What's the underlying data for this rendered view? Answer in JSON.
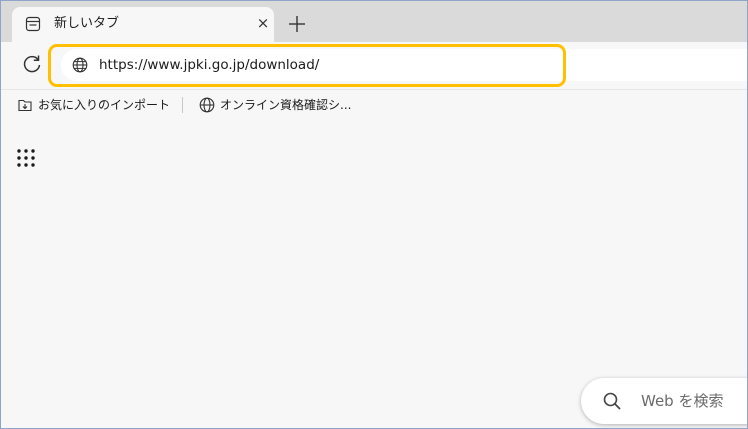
{
  "tab": {
    "title": "新しいタブ",
    "close_glyph": "×",
    "icon": "new-tab-page-icon"
  },
  "new_tab": {
    "icon": "plus-icon"
  },
  "toolbar": {
    "reload_icon": "reload-icon",
    "url": "https://www.jpki.go.jp/download/",
    "address_icon": "globe-icon",
    "highlight_color": "#ffc000"
  },
  "favorites": {
    "import_label": "お気に入りのインポート",
    "import_icon": "import-favorites-icon",
    "item_label": "オンライン資格確認シ...",
    "item_icon": "globe-icon"
  },
  "content": {
    "apps_icon": "apps-grid-icon",
    "search_placeholder": "Web を検索",
    "search_icon": "search-icon"
  }
}
